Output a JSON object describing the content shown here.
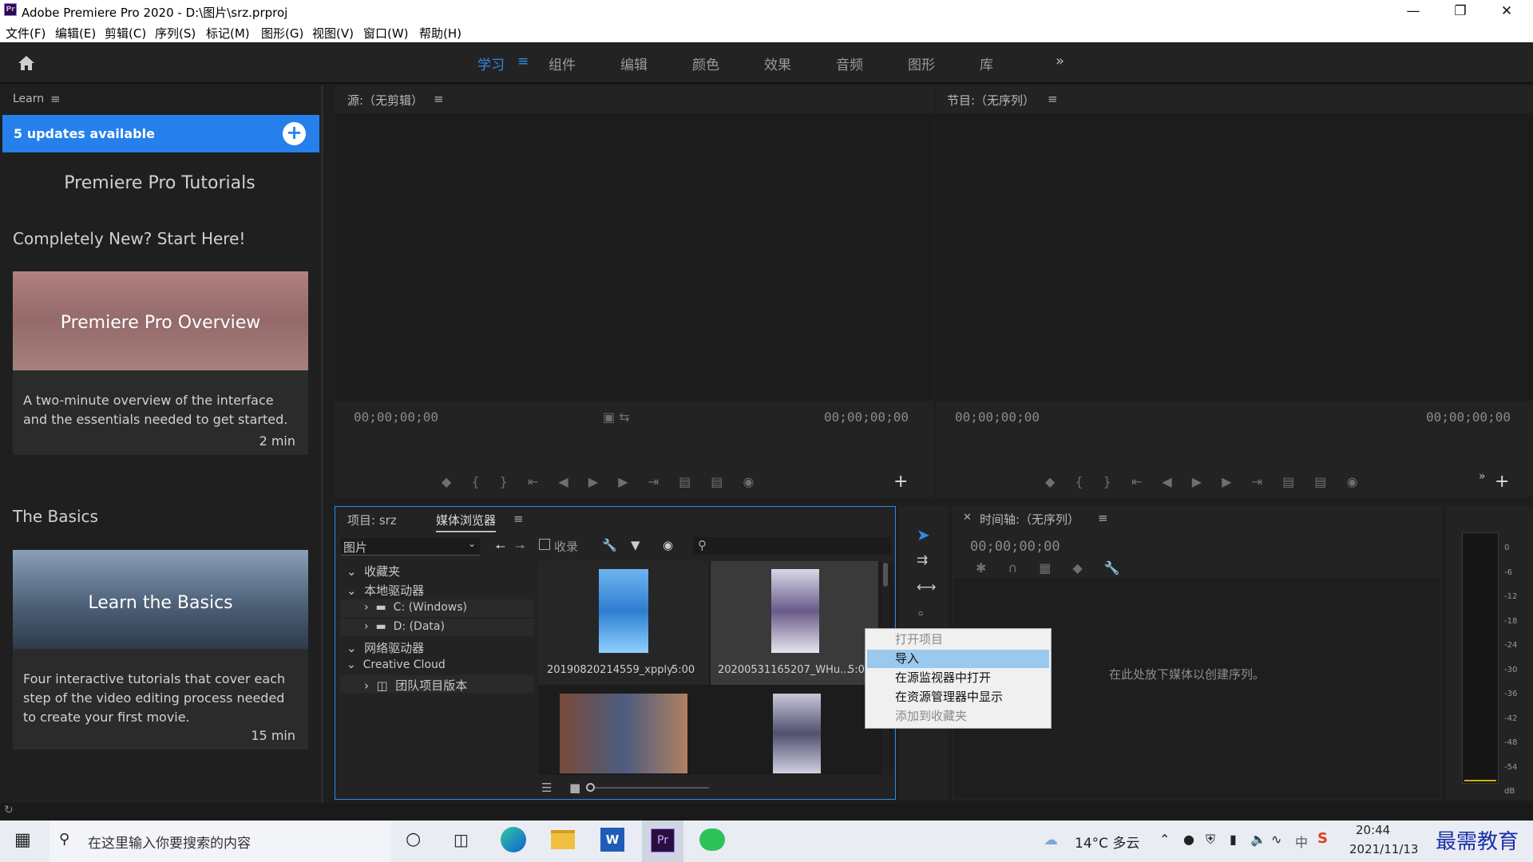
{
  "window": {
    "title": "Adobe Premiere Pro 2020 - D:\\图片\\srz.prproj",
    "app_icon": "Pr"
  },
  "menu": [
    "文件(F)",
    "编辑(E)",
    "剪辑(C)",
    "序列(S)",
    "标记(M)",
    "图形(G)",
    "视图(V)",
    "窗口(W)",
    "帮助(H)"
  ],
  "workspaces": [
    "学习",
    "组件",
    "编辑",
    "颜色",
    "效果",
    "音频",
    "图形",
    "库"
  ],
  "learn": {
    "panel_title": "Learn",
    "updates": "5 updates available",
    "heading": "Premiere Pro Tutorials",
    "section1": "Completely New? Start Here!",
    "card1": {
      "thumb": "Premiere Pro Overview",
      "desc": "A two-minute overview of the interface and the essentials needed to get started.",
      "duration": "2 min"
    },
    "section2": "The Basics",
    "card2": {
      "thumb": "Learn the Basics",
      "desc": "Four interactive tutorials that cover each step of the video editing process needed to create your first movie.",
      "duration": "15 min"
    }
  },
  "source": {
    "title": "源:（无剪辑）",
    "tc_left": "00;00;00;00",
    "tc_right": "00;00;00;00"
  },
  "program": {
    "title": "节目:（无序列）",
    "tc_left": "00;00;00;00",
    "tc_right": "00;00;00;00"
  },
  "project": {
    "tab1": "项目: srz",
    "tab2": "媒体浏览器",
    "folder_select": "图片",
    "favorites_label": "收录",
    "tree": [
      "收藏夹",
      "本地驱动器",
      "C: (Windows)",
      "D: (Data)",
      "网络驱动器",
      "Creative Cloud",
      "团队项目版本"
    ],
    "files": [
      {
        "name": "20190820214559_xpply",
        "dur": "5:00"
      },
      {
        "name": "20200531165207_WHu...",
        "dur": "5:00"
      }
    ]
  },
  "context_menu": {
    "items": [
      "打开项目",
      "导入",
      "在源监视器中打开",
      "在资源管理器中显示",
      "添加到收藏夹"
    ],
    "highlighted": 1,
    "disabled": [
      0,
      4
    ]
  },
  "timeline": {
    "title": "时间轴:（无序列）",
    "tc": "00;00;00;00",
    "drop_hint": "在此处放下媒体以创建序列。"
  },
  "meter": {
    "scale": [
      "0",
      "-6",
      "-12",
      "-18",
      "-24",
      "-30",
      "-36",
      "-42",
      "-48",
      "-54",
      "dB"
    ]
  },
  "taskbar": {
    "search_placeholder": "在这里输入你要搜索的内容",
    "weather": "14°C 多云",
    "time": "20:44",
    "date": "2021/11/13",
    "ime": "中",
    "watermark": "最需教育"
  },
  "colors": {
    "accent": "#2d8ceb",
    "highlight": "#99c9ef"
  }
}
